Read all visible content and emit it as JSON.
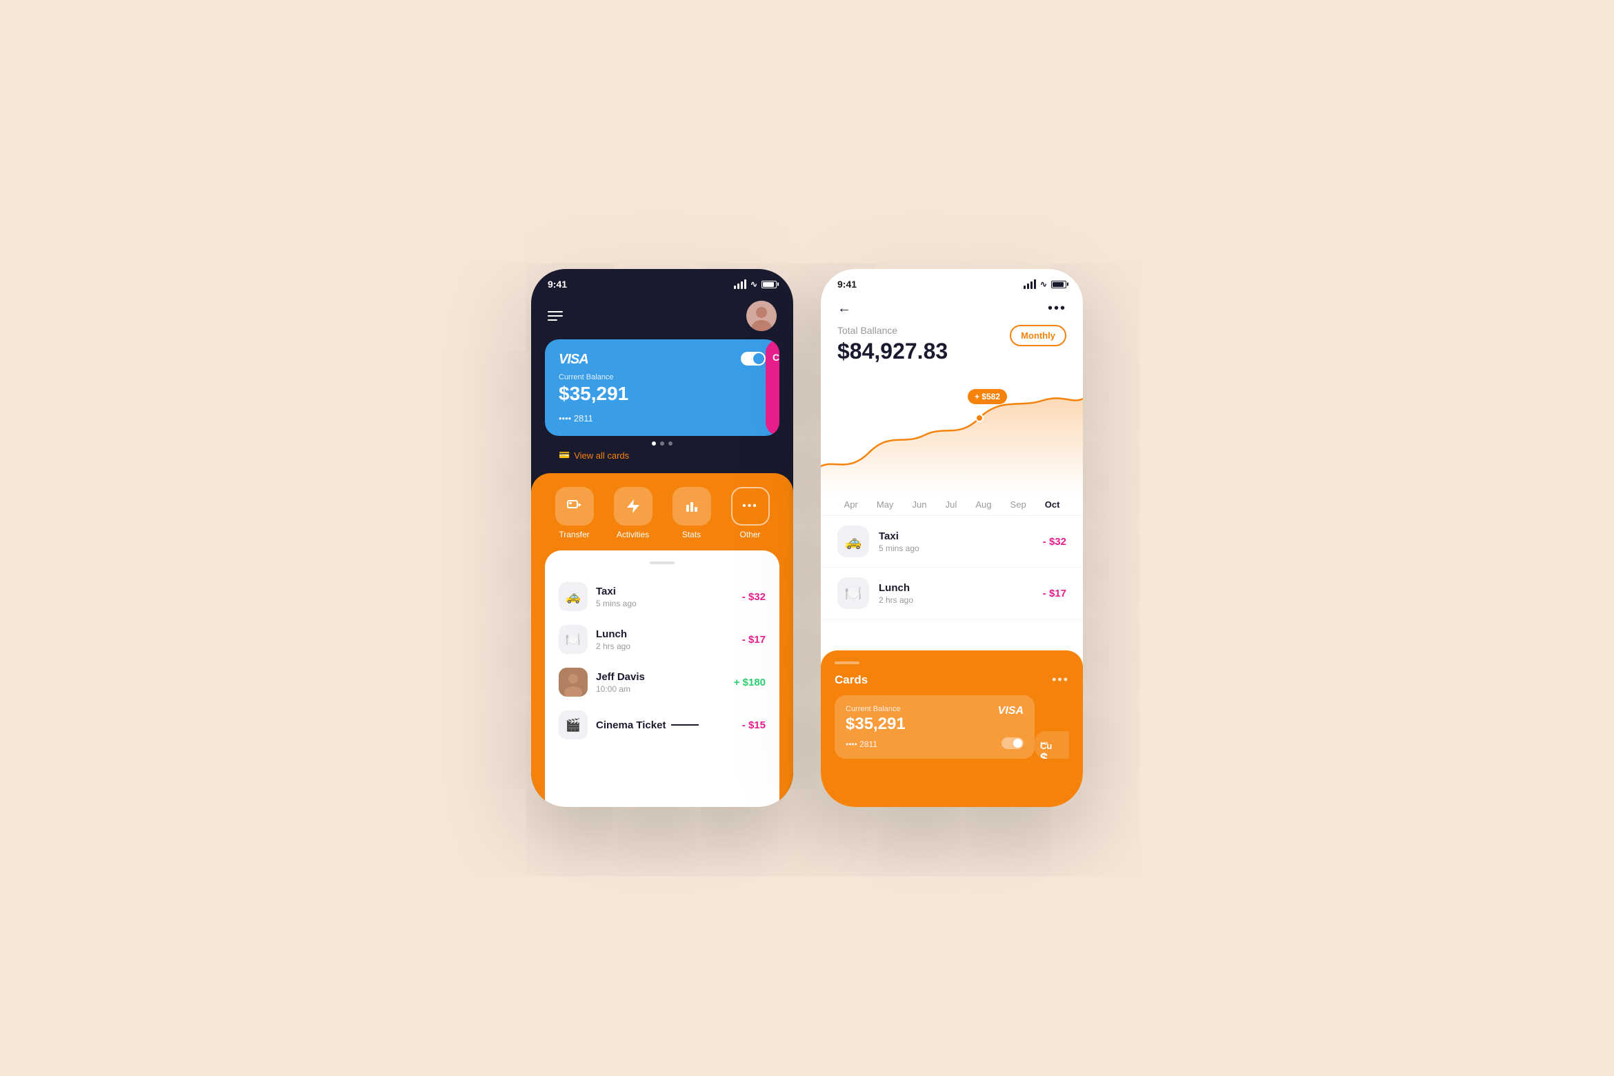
{
  "background": "#f5e6d8",
  "left_phone": {
    "status_time": "9:41",
    "header": {
      "menu_label": "menu",
      "avatar_emoji": "👤"
    },
    "card": {
      "brand": "VISA",
      "label": "Current Balance",
      "balance": "$35,291",
      "number": "•••• 2811",
      "peek_label": "Cu",
      "peek_amount": "$"
    },
    "dots": [
      "active",
      "inactive",
      "inactive"
    ],
    "view_all": "View all cards",
    "actions": [
      {
        "icon": "💳",
        "label": "Transfer"
      },
      {
        "icon": "⚡",
        "label": "Activities"
      },
      {
        "icon": "📊",
        "label": "Stats"
      },
      {
        "icon": "•••",
        "label": "Other"
      }
    ],
    "transactions": [
      {
        "icon": "🚕",
        "name": "Taxi",
        "time": "5 mins ago",
        "amount": "- $32",
        "type": "negative"
      },
      {
        "icon": "🍽️",
        "name": "Lunch",
        "time": "2 hrs ago",
        "amount": "- $17",
        "type": "negative"
      },
      {
        "icon": "person",
        "name": "Jeff Davis",
        "time": "10:00 am",
        "amount": "+ $180",
        "type": "positive"
      },
      {
        "icon": "🎬",
        "name": "Cinema Ticket",
        "time": "",
        "amount": "- $15",
        "type": "negative"
      }
    ]
  },
  "right_phone": {
    "status_time": "9:41",
    "header": {
      "back_label": "←",
      "dots_label": "•••"
    },
    "balance_section": {
      "label": "Total Ballance",
      "amount": "$84,927.83",
      "period_badge": "Monthly"
    },
    "chart": {
      "tooltip": "+ $582",
      "months": [
        "Apr",
        "May",
        "Jun",
        "Jul",
        "Aug",
        "Sep",
        "Oct"
      ]
    },
    "transactions": [
      {
        "icon": "🚕",
        "name": "Taxi",
        "time": "5 mins ago",
        "amount": "- $32",
        "type": "negative"
      },
      {
        "icon": "🍽️",
        "name": "Lunch",
        "time": "2 hrs ago",
        "amount": "- $17",
        "type": "negative"
      }
    ],
    "cards_section": {
      "title": "Cards",
      "dots": "•••",
      "card": {
        "label": "Current Balance",
        "balance": "$35,291",
        "number": "•••• 2811",
        "brand": "VISA"
      },
      "peek": "Cu"
    }
  }
}
